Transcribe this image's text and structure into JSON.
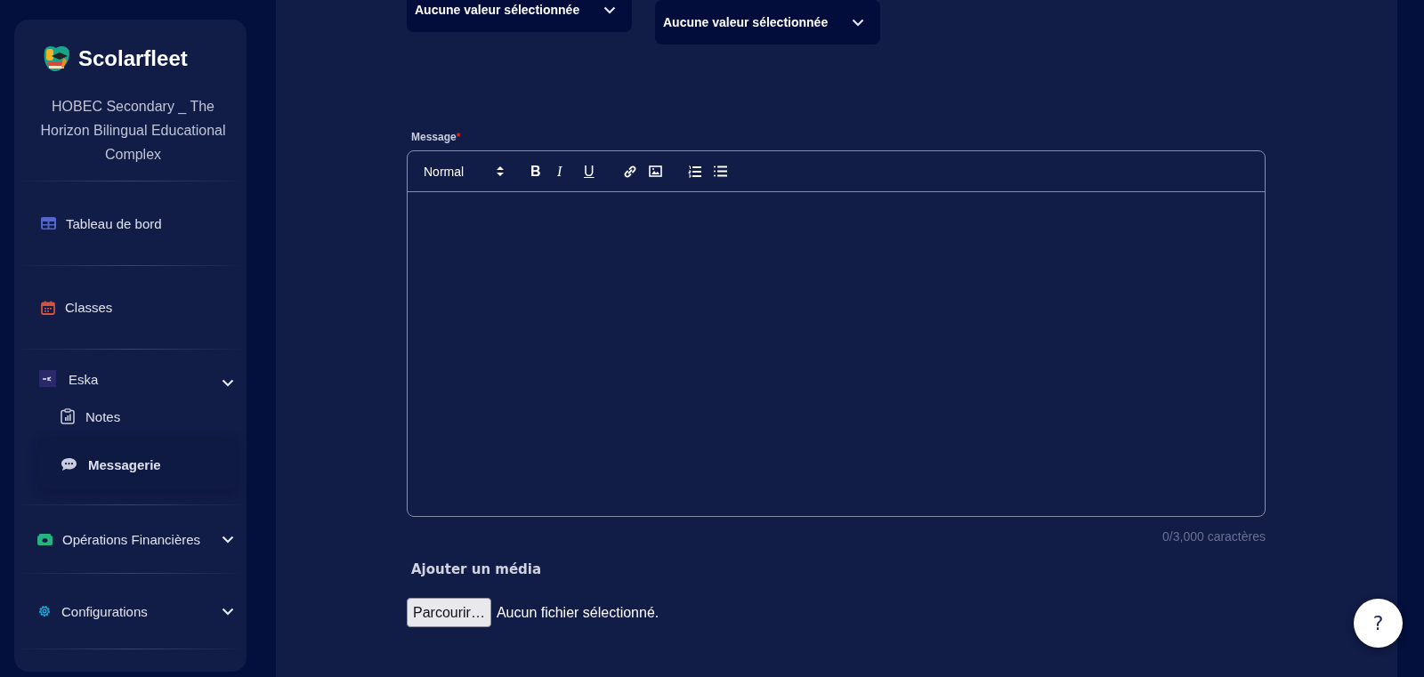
{
  "brand": {
    "name": "Scolarfleet"
  },
  "organization": "HOBEC Secondary _ The Horizon Bilingual Educational Complex",
  "nav": [
    {
      "kind": "link",
      "label": "Tableau de bord",
      "selected": false
    },
    {
      "kind": "link",
      "label": "Classes",
      "selected": false
    },
    {
      "kind": "group",
      "label": "Eska",
      "children": [
        {
          "label": "Notes",
          "selected": false
        },
        {
          "label": "Messagerie",
          "selected": true
        }
      ]
    },
    {
      "kind": "group",
      "label": "Opérations Financières"
    },
    {
      "kind": "group",
      "label": "Configurations"
    }
  ],
  "selects": [
    {
      "value": "Aucune valeur sélectionnée"
    },
    {
      "value": "Aucune valeur sélectionnée"
    }
  ],
  "message": {
    "label": "Message",
    "required_mark": "*",
    "toolbar": {
      "format": "Normal",
      "buttons": [
        "B",
        "I",
        "U"
      ]
    },
    "counter": "0/3,000 caractères"
  },
  "media": {
    "heading": "Ajouter un média",
    "button": "Parcourir…",
    "status": "Aucun fichier sélectionné."
  },
  "help": {
    "label": "?"
  }
}
